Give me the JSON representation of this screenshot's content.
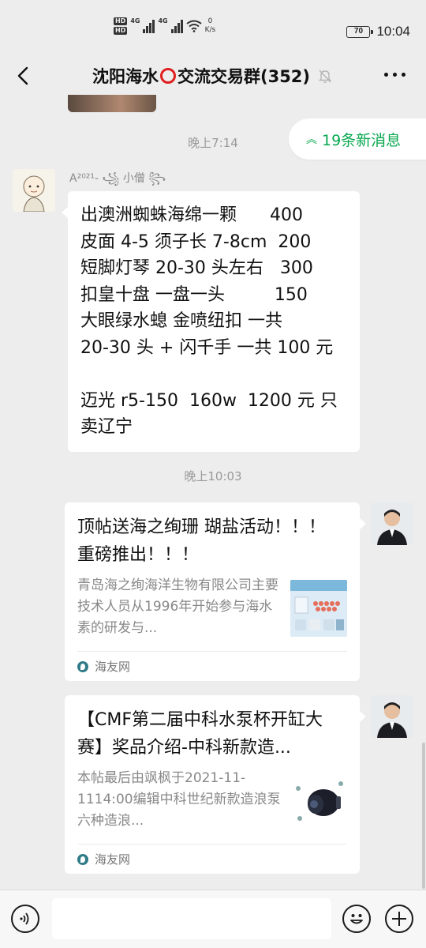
{
  "status_bar": {
    "network_hd_1": "HD",
    "network_hd_2": "HD",
    "signal_1": "4G",
    "signal_2": "4G",
    "speed_value": "0",
    "speed_unit": "K/s",
    "battery": "70",
    "time": "10:04"
  },
  "header": {
    "title_prefix": "沈阳海水",
    "title_suffix": "交流交易群(352)",
    "back_icon": "chevron-left-icon",
    "mute_icon": "bell-off-icon",
    "more_icon": "more-dots-icon"
  },
  "new_messages_pill": {
    "label": "19条新消息",
    "icon": "double-chevron-up-icon"
  },
  "messages": [
    {
      "type": "time",
      "text": "晚上7:14"
    },
    {
      "type": "text",
      "sender": "A²⁰²¹-  ꧁ 小僧 ꧂",
      "text": "出澳洲蜘蛛海绵一颗      400\n皮面 4-5 须子长 7-8cm  200\n短脚灯琴 20-30 头左右   300\n扣皇十盘 一盘一头         150\n大眼绿水螅 金喷纽扣 一共\n20-30 头 + 闪千手 一共 100 元\n\n迈光 r5-150  160w  1200 元 只\n卖辽宁"
    },
    {
      "type": "time",
      "text": "晚上10:03"
    },
    {
      "type": "link_card",
      "title": "顶帖送海之绚珊 瑚盐活动！！！ 重磅推出！！！",
      "desc": "青岛海之绚海洋生物有限公司主要技术人员从1996年开始参与海水素的研发与...",
      "source": "海友网"
    },
    {
      "type": "link_card",
      "title": "【CMF第二届中科水泵杯开缸大赛】奖品介绍-中科新款造...",
      "desc": "本帖最后由飒枫于2021-11-1114:00编辑中科世纪新款造浪泵六种造浪...",
      "source": "海友网"
    }
  ],
  "input_bar": {
    "voice_icon": "voice-icon",
    "emoji_icon": "emoji-icon",
    "plus_icon": "plus-icon",
    "input_value": ""
  },
  "colors": {
    "background": "#ededed",
    "accent_green": "#07a84f",
    "ring_red": "#e0201f"
  }
}
